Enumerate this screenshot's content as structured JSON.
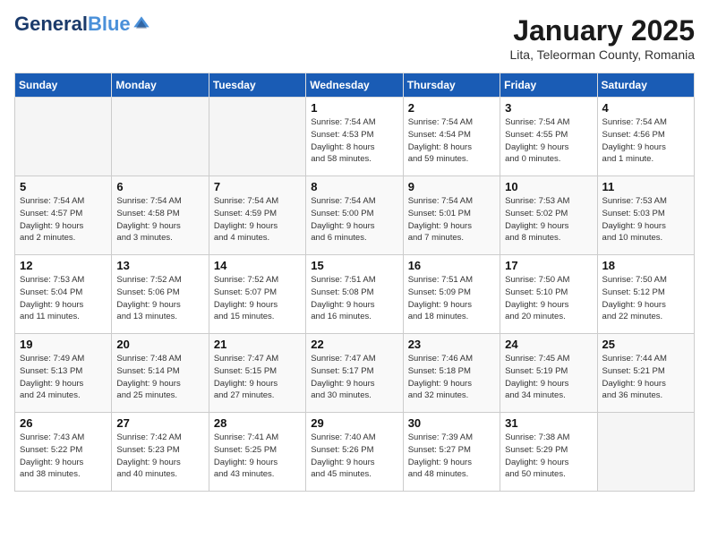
{
  "header": {
    "logo_line1": "General",
    "logo_line2": "Blue",
    "month": "January 2025",
    "location": "Lita, Teleorman County, Romania"
  },
  "weekdays": [
    "Sunday",
    "Monday",
    "Tuesday",
    "Wednesday",
    "Thursday",
    "Friday",
    "Saturday"
  ],
  "weeks": [
    [
      {
        "day": "",
        "info": ""
      },
      {
        "day": "",
        "info": ""
      },
      {
        "day": "",
        "info": ""
      },
      {
        "day": "1",
        "info": "Sunrise: 7:54 AM\nSunset: 4:53 PM\nDaylight: 8 hours\nand 58 minutes."
      },
      {
        "day": "2",
        "info": "Sunrise: 7:54 AM\nSunset: 4:54 PM\nDaylight: 8 hours\nand 59 minutes."
      },
      {
        "day": "3",
        "info": "Sunrise: 7:54 AM\nSunset: 4:55 PM\nDaylight: 9 hours\nand 0 minutes."
      },
      {
        "day": "4",
        "info": "Sunrise: 7:54 AM\nSunset: 4:56 PM\nDaylight: 9 hours\nand 1 minute."
      }
    ],
    [
      {
        "day": "5",
        "info": "Sunrise: 7:54 AM\nSunset: 4:57 PM\nDaylight: 9 hours\nand 2 minutes."
      },
      {
        "day": "6",
        "info": "Sunrise: 7:54 AM\nSunset: 4:58 PM\nDaylight: 9 hours\nand 3 minutes."
      },
      {
        "day": "7",
        "info": "Sunrise: 7:54 AM\nSunset: 4:59 PM\nDaylight: 9 hours\nand 4 minutes."
      },
      {
        "day": "8",
        "info": "Sunrise: 7:54 AM\nSunset: 5:00 PM\nDaylight: 9 hours\nand 6 minutes."
      },
      {
        "day": "9",
        "info": "Sunrise: 7:54 AM\nSunset: 5:01 PM\nDaylight: 9 hours\nand 7 minutes."
      },
      {
        "day": "10",
        "info": "Sunrise: 7:53 AM\nSunset: 5:02 PM\nDaylight: 9 hours\nand 8 minutes."
      },
      {
        "day": "11",
        "info": "Sunrise: 7:53 AM\nSunset: 5:03 PM\nDaylight: 9 hours\nand 10 minutes."
      }
    ],
    [
      {
        "day": "12",
        "info": "Sunrise: 7:53 AM\nSunset: 5:04 PM\nDaylight: 9 hours\nand 11 minutes."
      },
      {
        "day": "13",
        "info": "Sunrise: 7:52 AM\nSunset: 5:06 PM\nDaylight: 9 hours\nand 13 minutes."
      },
      {
        "day": "14",
        "info": "Sunrise: 7:52 AM\nSunset: 5:07 PM\nDaylight: 9 hours\nand 15 minutes."
      },
      {
        "day": "15",
        "info": "Sunrise: 7:51 AM\nSunset: 5:08 PM\nDaylight: 9 hours\nand 16 minutes."
      },
      {
        "day": "16",
        "info": "Sunrise: 7:51 AM\nSunset: 5:09 PM\nDaylight: 9 hours\nand 18 minutes."
      },
      {
        "day": "17",
        "info": "Sunrise: 7:50 AM\nSunset: 5:10 PM\nDaylight: 9 hours\nand 20 minutes."
      },
      {
        "day": "18",
        "info": "Sunrise: 7:50 AM\nSunset: 5:12 PM\nDaylight: 9 hours\nand 22 minutes."
      }
    ],
    [
      {
        "day": "19",
        "info": "Sunrise: 7:49 AM\nSunset: 5:13 PM\nDaylight: 9 hours\nand 24 minutes."
      },
      {
        "day": "20",
        "info": "Sunrise: 7:48 AM\nSunset: 5:14 PM\nDaylight: 9 hours\nand 25 minutes."
      },
      {
        "day": "21",
        "info": "Sunrise: 7:47 AM\nSunset: 5:15 PM\nDaylight: 9 hours\nand 27 minutes."
      },
      {
        "day": "22",
        "info": "Sunrise: 7:47 AM\nSunset: 5:17 PM\nDaylight: 9 hours\nand 30 minutes."
      },
      {
        "day": "23",
        "info": "Sunrise: 7:46 AM\nSunset: 5:18 PM\nDaylight: 9 hours\nand 32 minutes."
      },
      {
        "day": "24",
        "info": "Sunrise: 7:45 AM\nSunset: 5:19 PM\nDaylight: 9 hours\nand 34 minutes."
      },
      {
        "day": "25",
        "info": "Sunrise: 7:44 AM\nSunset: 5:21 PM\nDaylight: 9 hours\nand 36 minutes."
      }
    ],
    [
      {
        "day": "26",
        "info": "Sunrise: 7:43 AM\nSunset: 5:22 PM\nDaylight: 9 hours\nand 38 minutes."
      },
      {
        "day": "27",
        "info": "Sunrise: 7:42 AM\nSunset: 5:23 PM\nDaylight: 9 hours\nand 40 minutes."
      },
      {
        "day": "28",
        "info": "Sunrise: 7:41 AM\nSunset: 5:25 PM\nDaylight: 9 hours\nand 43 minutes."
      },
      {
        "day": "29",
        "info": "Sunrise: 7:40 AM\nSunset: 5:26 PM\nDaylight: 9 hours\nand 45 minutes."
      },
      {
        "day": "30",
        "info": "Sunrise: 7:39 AM\nSunset: 5:27 PM\nDaylight: 9 hours\nand 48 minutes."
      },
      {
        "day": "31",
        "info": "Sunrise: 7:38 AM\nSunset: 5:29 PM\nDaylight: 9 hours\nand 50 minutes."
      },
      {
        "day": "",
        "info": ""
      }
    ]
  ]
}
